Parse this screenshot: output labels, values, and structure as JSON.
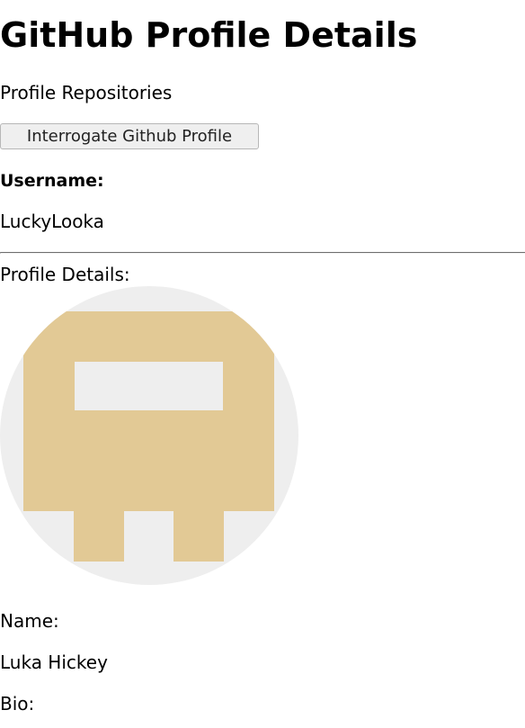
{
  "header": {
    "title": "GitHub Profile Details",
    "subtitle": "Profile Repositories"
  },
  "actions": {
    "interrogate_label": "Interrogate Github Profile"
  },
  "username": {
    "label": "Username:",
    "value": "LuckyLooka"
  },
  "profile": {
    "section_label": "Profile Details:",
    "avatar_icon": "identicon-avatar",
    "avatar_colors": {
      "background": "#eeeeee",
      "pattern": "#e2c995"
    },
    "name_label": "Name:",
    "name_value": "Luka Hickey",
    "bio_label": "Bio:"
  }
}
